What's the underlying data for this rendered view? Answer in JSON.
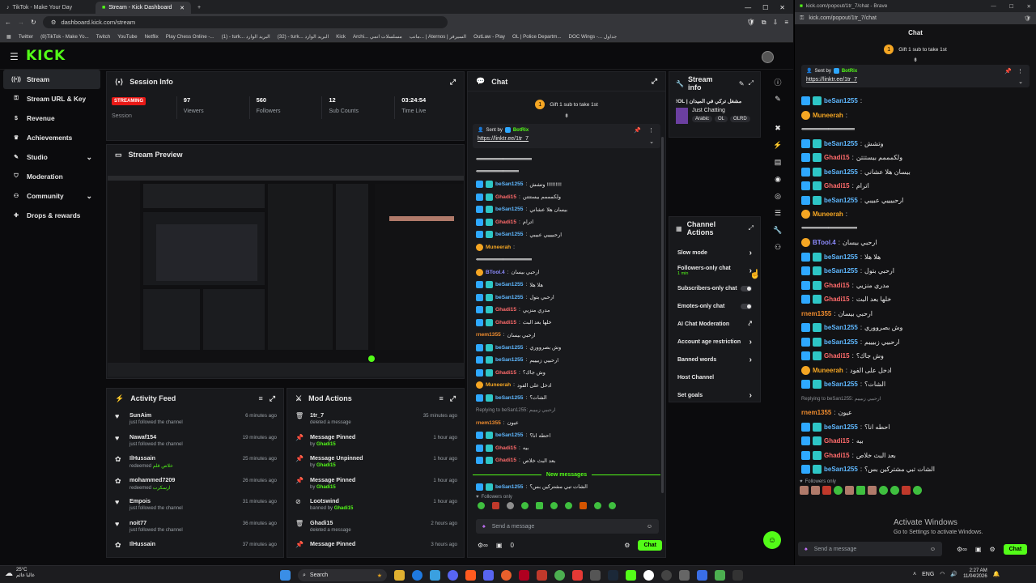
{
  "browser_tabs": [
    {
      "label": "TikTok - Make Your Day",
      "active": false
    },
    {
      "label": "Stream - Kick Dashboard",
      "active": true
    }
  ],
  "address_url": "dashboard.kick.com/stream",
  "bookmarks": [
    "Twitter",
    "(8)TikTok - Make Yo...",
    "Twitch",
    "YouTube",
    "Netflix",
    "Play Chess Online -...",
    "(1) - turk... البريد الوارد",
    "(32) - turk... البريد الوارد",
    "Kick",
    "Archi... مسلسلات انمي",
    "ماتب... | Aternos | السيرفر",
    "OutLaw - Play",
    "OL | Police Departm...",
    "DOC Wings -... جداول"
  ],
  "logo": "KICK",
  "sidebar": [
    {
      "label": "Stream",
      "icon": "radio-icon",
      "active": true,
      "chev": false
    },
    {
      "label": "Stream URL & Key",
      "icon": "key-icon",
      "chev": false
    },
    {
      "label": "Revenue",
      "icon": "dollar-icon",
      "chev": false
    },
    {
      "label": "Achievements",
      "icon": "trophy-icon",
      "chev": false
    },
    {
      "label": "Studio",
      "icon": "pen-icon",
      "chev": true
    },
    {
      "label": "Moderation",
      "icon": "shield-icon",
      "chev": false
    },
    {
      "label": "Community",
      "icon": "users-icon",
      "chev": true
    },
    {
      "label": "Drops & rewards",
      "icon": "gift-icon",
      "chev": false
    }
  ],
  "session": {
    "title": "Session Info",
    "status": "STREAMING",
    "status_label": "Session",
    "stats": [
      {
        "value": "97",
        "label": "Viewers"
      },
      {
        "value": "560",
        "label": "Followers"
      },
      {
        "value": "12",
        "label": "Sub Counts"
      },
      {
        "value": "03:24:54",
        "label": "Time Live"
      }
    ]
  },
  "preview": {
    "title": "Stream Preview"
  },
  "activity": {
    "title": "Activity Feed",
    "items": [
      {
        "icon": "heart-icon",
        "name": "SunAim",
        "sub": "just followed the channel",
        "time": "6 minutes ago"
      },
      {
        "icon": "heart-icon",
        "name": "Nawaf154",
        "sub": "just followed the channel",
        "time": "19 minutes ago"
      },
      {
        "icon": "reward-icon",
        "name": "IlHussain",
        "sub": "redeemed",
        "extra": "خلاص قلم",
        "time": "25 minutes ago"
      },
      {
        "icon": "reward-icon",
        "name": "mohammed7209",
        "sub": "redeemed",
        "extra": "ارسكرت",
        "time": "26 minutes ago"
      },
      {
        "icon": "heart-icon",
        "name": "Empois",
        "sub": "just followed the channel",
        "time": "31 minutes ago"
      },
      {
        "icon": "heart-icon",
        "name": "noit77",
        "sub": "just followed the channel",
        "time": "36 minutes ago"
      },
      {
        "icon": "reward-icon",
        "name": "IlHussain",
        "sub": "",
        "time": "37 minutes ago"
      }
    ]
  },
  "mod": {
    "title": "Mod Actions",
    "items": [
      {
        "icon": "trash-icon",
        "name": "1tr_7",
        "sub": "deleted a message",
        "by": "",
        "time": "35 minutes ago"
      },
      {
        "icon": "pin-icon",
        "name": "Message Pinned",
        "sub": "by",
        "by": "Ghadi15",
        "time": "1 hour ago"
      },
      {
        "icon": "pin-icon",
        "name": "Message Unpinned",
        "sub": "by",
        "by": "Ghadi15",
        "time": "1 hour ago"
      },
      {
        "icon": "pin-icon",
        "name": "Message Pinned",
        "sub": "by",
        "by": "Ghadi15",
        "time": "1 hour ago"
      },
      {
        "icon": "ban-icon",
        "name": "Lootswind",
        "sub": "banned by",
        "by": "Ghadi15",
        "time": "1 hour ago"
      },
      {
        "icon": "trash-icon",
        "name": "Ghadi15",
        "sub": "deleted a message",
        "by": "",
        "time": "2 hours ago"
      },
      {
        "icon": "pin-icon",
        "name": "Message Pinned",
        "sub": "",
        "by": "",
        "time": "3 hours ago"
      }
    ]
  },
  "chat": {
    "title": "Chat",
    "gift": "Gift 1 sub to take 1st",
    "pinned_by": "Sent by",
    "pinned_user": "BotRix",
    "pinned_link": "https://linktr.ee/1tr_7",
    "new_messages": "New messages",
    "followers_only": "Followers only",
    "placeholder": "Send a message",
    "send": "Chat",
    "viewer_count": "0",
    "lines": [
      {
        "u": "",
        "m": "‹‹‹‹‹‹‹‹‹‹‹‹‹‹‹‹‹‹‹‹‹‹‹‹‹‹‹‹‹‹‹‹‹‹‹‹‹‹‹‹‹‹‹‹‹‹‹‹‹‹‹‹‹‹‹‹‹‹‹‹‹‹‹‹‹‹‹‹‹",
        "c": "#ffffff",
        "b": ""
      },
      {
        "u": "",
        "m": "‹‹‹‹‹‹‹‹‹‹‹‹‹‹‹‹‹‹‹‹‹‹‹‹‹‹‹‹‹‹‹‹‹‹‹‹‹‹‹‹‹‹‹‹‹‹‹‹‹‹‹‹‹",
        "c": "#ffffff",
        "b": ""
      },
      {
        "u": "beSan1255",
        "m": "وتشش !!!!!!!!!!",
        "c": "#5fb8ff",
        "b": "bb"
      },
      {
        "u": "Ghadi15",
        "m": "ولكمممم بيستتتن",
        "c": "#ff6b6b",
        "b": "bb"
      },
      {
        "u": "beSan1255",
        "m": "بيسان هلا عشاني",
        "c": "#5fb8ff",
        "b": "bb"
      },
      {
        "u": "Ghadi15",
        "m": "اترام",
        "c": "#ff6b6b",
        "b": "bb"
      },
      {
        "u": "beSan1255",
        "m": "ارحبيييي عبيبي",
        "c": "#5fb8ff",
        "b": "bb"
      },
      {
        "u": "Muneerah",
        "m": "",
        "c": "#f5a623",
        "b": "o"
      },
      {
        "u": "",
        "m": "‹‹‹‹‹‹‹‹‹‹‹‹‹‹‹‹‹‹‹‹‹‹‹‹‹‹‹‹‹‹‹‹‹‹‹‹‹‹‹‹‹‹‹‹‹‹‹‹‹‹‹‹‹‹‹‹‹‹‹‹‹‹‹‹‹‹‹‹‹",
        "c": "#ffffff",
        "b": ""
      },
      {
        "u": "BTool.4",
        "m": "ارحبي بيسان",
        "c": "#8e8cff",
        "b": "o"
      },
      {
        "u": "beSan1255",
        "m": "هلا هلا",
        "c": "#5fb8ff",
        "b": "bb"
      },
      {
        "u": "beSan1255",
        "m": "ارحبي بتول",
        "c": "#5fb8ff",
        "b": "bb"
      },
      {
        "u": "Ghadi15",
        "m": "مدري منزيي",
        "c": "#ff6b6b",
        "b": "bb"
      },
      {
        "u": "Ghadi15",
        "m": "خلها بعد البث",
        "c": "#ff6b6b",
        "b": "bb"
      },
      {
        "u": "rnem1355",
        "m": "ارحبي بيسان",
        "c": "#f08c2e",
        "b": ""
      },
      {
        "u": "beSan1255",
        "m": "وش بصرووري",
        "c": "#5fb8ff",
        "b": "bb"
      },
      {
        "u": "beSan1255",
        "m": "ارحبيي زبيييم",
        "c": "#5fb8ff",
        "b": "bb"
      },
      {
        "u": "Ghadi15",
        "m": "وش جاك؟",
        "c": "#ff6b6b",
        "b": "bb"
      },
      {
        "u": "Muneerah",
        "m": "ادخل على الفود",
        "c": "#f5a623",
        "b": "o"
      },
      {
        "u": "beSan1255",
        "m": "الشات؟",
        "c": "#5fb8ff",
        "b": "bb"
      },
      {
        "u": "",
        "m": "Replying to beSan1255: ارحبيي زبيييم",
        "c": "#8c8f94",
        "b": ""
      },
      {
        "u": "rnem1355",
        "m": "عيون",
        "c": "#f08c2e",
        "b": ""
      },
      {
        "u": "beSan1255",
        "m": "احطه انا؟",
        "c": "#5fb8ff",
        "b": "bb"
      },
      {
        "u": "Ghadi15",
        "m": "بيه",
        "c": "#ff6b6b",
        "b": "bb"
      },
      {
        "u": "Ghadi15",
        "m": "بعد البث خلاص",
        "c": "#ff6b6b",
        "b": "bb"
      }
    ],
    "last_line": {
      "u": "beSan1255",
      "m": "الشات تبي مشتركين بس؟"
    }
  },
  "info": {
    "title": "Stream info",
    "stream_title": "!OL | مشغل تركي في الميدان",
    "category": "Just Chatting",
    "tags": [
      "Arabic",
      "OL",
      "OLRD"
    ]
  },
  "actions": {
    "title": "Channel Actions",
    "items": [
      {
        "label": "Slow mode",
        "kind": "chev"
      },
      {
        "label": "Followers-only chat",
        "kind": "chev",
        "sub": "1 min"
      },
      {
        "label": "Subscribers-only chat",
        "kind": "toggle"
      },
      {
        "label": "Emotes-only chat",
        "kind": "toggle"
      },
      {
        "label": "AI Chat Moderation",
        "kind": "ext"
      },
      {
        "label": "Account age restriction",
        "kind": "chev"
      },
      {
        "label": "Banned words",
        "kind": "chev"
      },
      {
        "label": "Host Channel",
        "kind": "none"
      },
      {
        "label": "Set goals",
        "kind": "chev"
      }
    ]
  },
  "popout": {
    "tab": "kick.com/popout/1tr_7/chat - Brave",
    "url": "kick.com/popout/1tr_7/chat",
    "title": "Chat",
    "gift": "Gift 1 sub to take 1st",
    "pinned_by": "Sent by",
    "pinned_user": "BotRix",
    "pinned_link": "https://linktr.ee/1tr_7",
    "followers_only": "Followers only",
    "placeholder": "Send a message",
    "send": "Chat",
    "watermark1": "Activate Windows",
    "watermark2": "Go to Settings to activate Windows.",
    "lines": [
      {
        "u": "beSan1255",
        "m": "",
        "c": "#5fb8ff",
        "b": "bb"
      },
      {
        "u": "Muneerah",
        "m": "",
        "c": "#f5a623",
        "b": "o"
      },
      {
        "u": "",
        "m": "‹‹‹‹‹‹‹‹‹‹‹‹‹‹‹‹‹‹‹‹‹‹‹‹‹‹‹‹‹‹‹‹‹‹‹‹‹‹‹‹‹‹‹‹‹‹‹‹‹‹‹‹‹‹‹‹‹‹‹‹‹‹‹‹‹‹",
        "c": "#ffffff",
        "b": ""
      },
      {
        "u": "beSan1255",
        "m": "وتشش",
        "c": "#5fb8ff",
        "b": "bb"
      },
      {
        "u": "Ghadi15",
        "m": "ولكمممم بيستتتن",
        "c": "#ff6b6b",
        "b": "bb"
      },
      {
        "u": "beSan1255",
        "m": "بيسان هلا عشاني",
        "c": "#5fb8ff",
        "b": "bb"
      },
      {
        "u": "Ghadi15",
        "m": "اترام",
        "c": "#ff6b6b",
        "b": "bb"
      },
      {
        "u": "beSan1255",
        "m": "ارحبيييي عبيبي",
        "c": "#5fb8ff",
        "b": "bb"
      },
      {
        "u": "Muneerah",
        "m": "",
        "c": "#f5a623",
        "b": "o"
      },
      {
        "u": "",
        "m": "‹‹‹‹‹‹‹‹‹‹‹‹‹‹‹‹‹‹‹‹‹‹‹‹‹‹‹‹‹‹‹‹‹‹‹‹‹‹‹‹‹‹‹‹‹‹‹‹‹‹‹‹‹‹‹‹‹‹‹‹‹‹‹‹‹‹‹‹‹",
        "c": "#ffffff",
        "b": ""
      },
      {
        "u": "BTool.4",
        "m": "ارحبي بيسان",
        "c": "#8e8cff",
        "b": "o"
      },
      {
        "u": "beSan1255",
        "m": "هلا هلا",
        "c": "#5fb8ff",
        "b": "bb"
      },
      {
        "u": "beSan1255",
        "m": "ارحبي بتول",
        "c": "#5fb8ff",
        "b": "bb"
      },
      {
        "u": "Ghadi15",
        "m": "مدري منزيي",
        "c": "#ff6b6b",
        "b": "bb"
      },
      {
        "u": "Ghadi15",
        "m": "خلها بعد البث",
        "c": "#ff6b6b",
        "b": "bb"
      },
      {
        "u": "rnem1355",
        "m": "ارحبي بيسان",
        "c": "#f08c2e",
        "b": ""
      },
      {
        "u": "beSan1255",
        "m": "وش بصرووري",
        "c": "#5fb8ff",
        "b": "bb"
      },
      {
        "u": "beSan1255",
        "m": "ارحبيي زبيييم",
        "c": "#5fb8ff",
        "b": "bb"
      },
      {
        "u": "Ghadi15",
        "m": "وش جاك؟",
        "c": "#ff6b6b",
        "b": "bb"
      },
      {
        "u": "Muneerah",
        "m": "ادخل على الفود",
        "c": "#f5a623",
        "b": "o"
      },
      {
        "u": "beSan1255",
        "m": "الشات؟",
        "c": "#5fb8ff",
        "b": "bb"
      },
      {
        "u": "",
        "m": "Replying to beSan1255: ارحبيي زبيييم",
        "c": "#8c8f94",
        "b": ""
      },
      {
        "u": "rnem1355",
        "m": "عيون",
        "c": "#f08c2e",
        "b": ""
      },
      {
        "u": "beSan1255",
        "m": "احطه انا؟",
        "c": "#5fb8ff",
        "b": "bb"
      },
      {
        "u": "Ghadi15",
        "m": "بيه",
        "c": "#ff6b6b",
        "b": "bb"
      },
      {
        "u": "Ghadi15",
        "m": "بعد البث خلاص",
        "c": "#ff6b6b",
        "b": "bb"
      },
      {
        "u": "beSan1255",
        "m": "الشات تبي مشتركين بس؟",
        "c": "#5fb8ff",
        "b": "bb"
      }
    ]
  },
  "taskbar": {
    "weather_temp": "25°C",
    "weather_desc": "غالبا غائم",
    "search": "Search",
    "lang": "ENG",
    "time": "2:27 AM",
    "date": "11/04/2026"
  },
  "colors": {
    "accent": "#53fc18",
    "panel": "#18191c",
    "bg": "#0b0b0d",
    "streaming": "#e91916"
  }
}
